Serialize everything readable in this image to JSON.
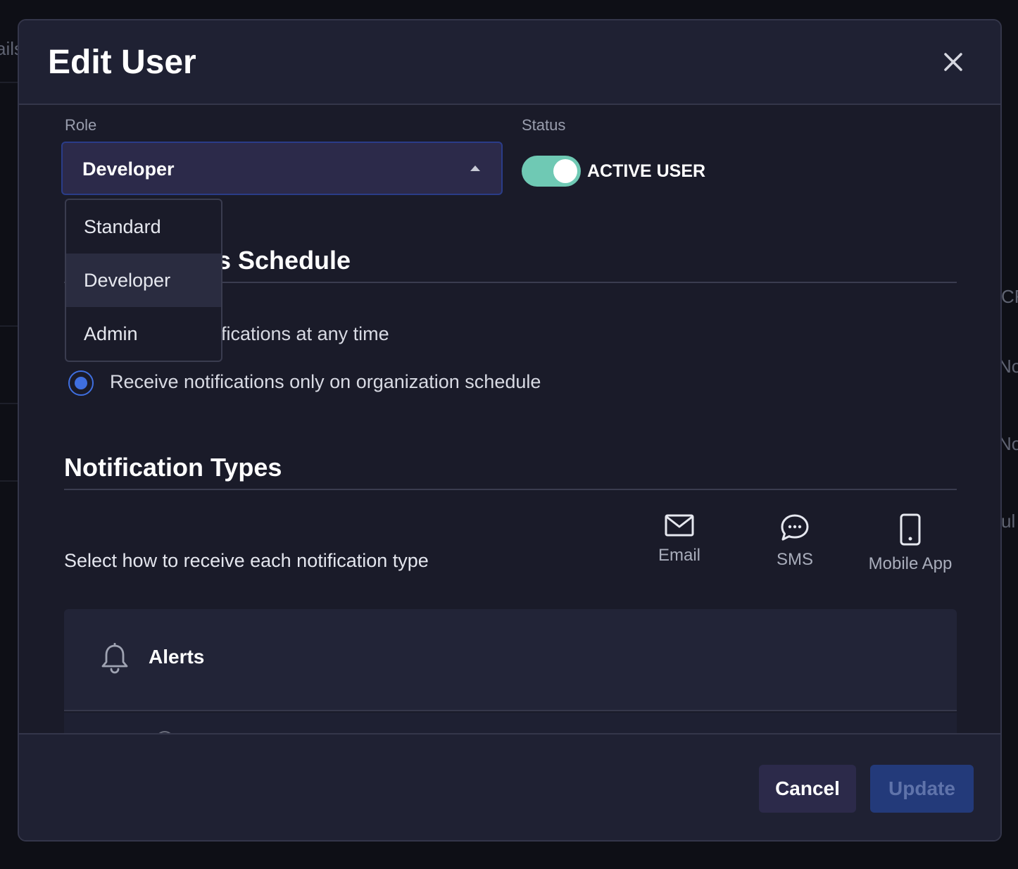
{
  "background": {
    "fragments": [
      "ails",
      "CR",
      "No",
      "No",
      "ul"
    ]
  },
  "modal": {
    "title": "Edit User",
    "close_icon": "close-icon"
  },
  "role": {
    "label": "Role",
    "selected": "Developer",
    "options": [
      "Standard",
      "Developer",
      "Admin"
    ]
  },
  "status": {
    "label": "Status",
    "toggle_on": true,
    "toggle_text": "ACTIVE USER"
  },
  "schedule": {
    "title": "Notifications Schedule",
    "visible_title": "s Schedule",
    "option_any_time": "Receive notifications at any time",
    "option_any_time_visible": "fications at any time",
    "option_org": "Receive notifications only on organization schedule",
    "selected_option": "organization"
  },
  "notification_types": {
    "title": "Notification Types",
    "helper": "Select how to receive each notification type",
    "channels": [
      {
        "label": "Email",
        "icon": "mail-icon"
      },
      {
        "label": "SMS",
        "icon": "chat-bubble-icon"
      },
      {
        "label": "Mobile App",
        "icon": "phone-icon"
      }
    ],
    "types": [
      {
        "name": "Alerts",
        "icon": "bell-icon"
      }
    ]
  },
  "footer": {
    "cancel_label": "Cancel",
    "update_label": "Update"
  },
  "colors": {
    "accent_blue": "#3f6fe0",
    "toggle_green": "#6fc9b4",
    "modal_bg": "#1a1b29"
  }
}
